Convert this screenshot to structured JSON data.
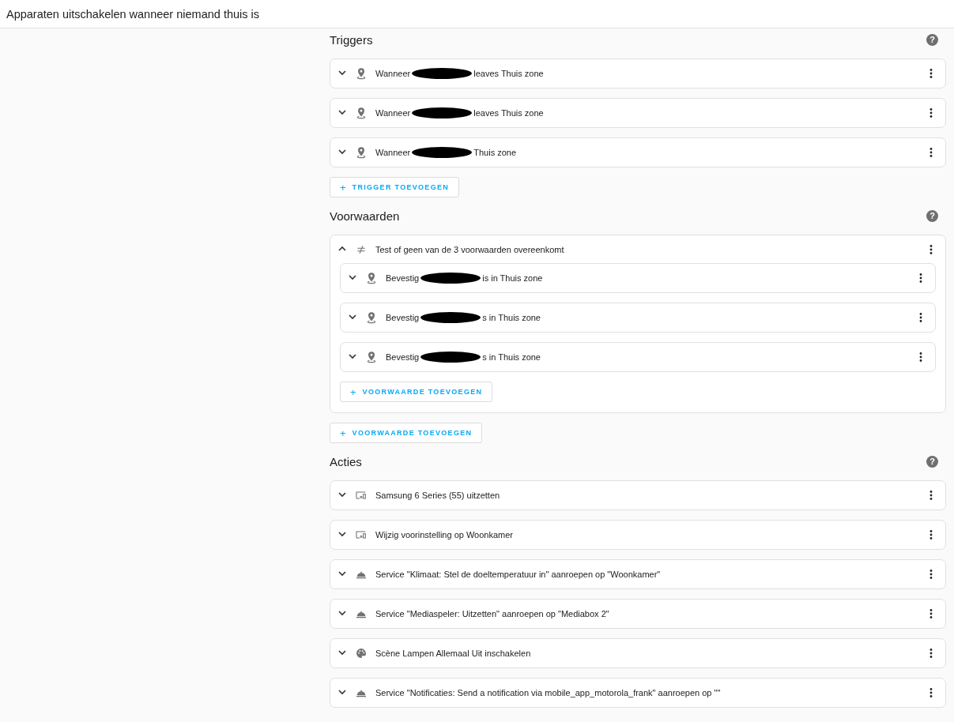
{
  "header": {
    "title": "Apparaten uitschakelen wanneer niemand thuis is"
  },
  "sections": [
    {
      "title": "Triggers",
      "help": "?",
      "rows": [
        {
          "kind": "zone",
          "expanded": false,
          "before": "Wanneer",
          "after": "leaves Thuis zone"
        },
        {
          "kind": "zone",
          "expanded": false,
          "before": "Wanneer",
          "after": "leaves Thuis zone"
        },
        {
          "kind": "zone",
          "expanded": false,
          "before": "Wanneer",
          "after": "Thuis zone"
        }
      ],
      "add_button": {
        "icon": "+",
        "label": "TRIGGER TOEVOEGEN"
      }
    },
    {
      "title": "Voorwaarden",
      "help": "?",
      "rows": [
        {
          "kind": "not",
          "expanded": true,
          "label": "Test of geen van de 3 voorwaarden overeenkomt",
          "children": [
            {
              "kind": "zone",
              "expanded": false,
              "before": "Bevestig",
              "after": "is in Thuis zone"
            },
            {
              "kind": "zone",
              "expanded": false,
              "before": "Bevestig",
              "after": "s in Thuis zone"
            },
            {
              "kind": "zone",
              "expanded": false,
              "before": "Bevestig",
              "after": "s in Thuis zone"
            }
          ],
          "add_button": {
            "icon": "+",
            "label": "VOORWAARDE TOEVOEGEN"
          }
        }
      ],
      "add_button": {
        "icon": "+",
        "label": "VOORWAARDE TOEVOEGEN"
      }
    },
    {
      "title": "Acties",
      "help": "?",
      "rows": [
        {
          "kind": "device",
          "expanded": false,
          "label": "Samsung 6 Series (55) uitzetten"
        },
        {
          "kind": "device",
          "expanded": false,
          "label": "Wijzig voorinstelling op Woonkamer"
        },
        {
          "kind": "service",
          "expanded": false,
          "label": "Service \"Klimaat: Stel de doeltemperatuur in\" aanroepen op \"Woonkamer\""
        },
        {
          "kind": "service",
          "expanded": false,
          "label": "Service \"Mediaspeler: Uitzetten\" aanroepen op \"Mediabox 2\""
        },
        {
          "kind": "scene",
          "expanded": false,
          "label": "Scène Lampen Allemaal Uit inschakelen"
        },
        {
          "kind": "service",
          "expanded": false,
          "label": "Service \"Notificaties: Send a notification via mobile_app_motorola_frank\" aanroepen op \"\""
        }
      ]
    }
  ]
}
